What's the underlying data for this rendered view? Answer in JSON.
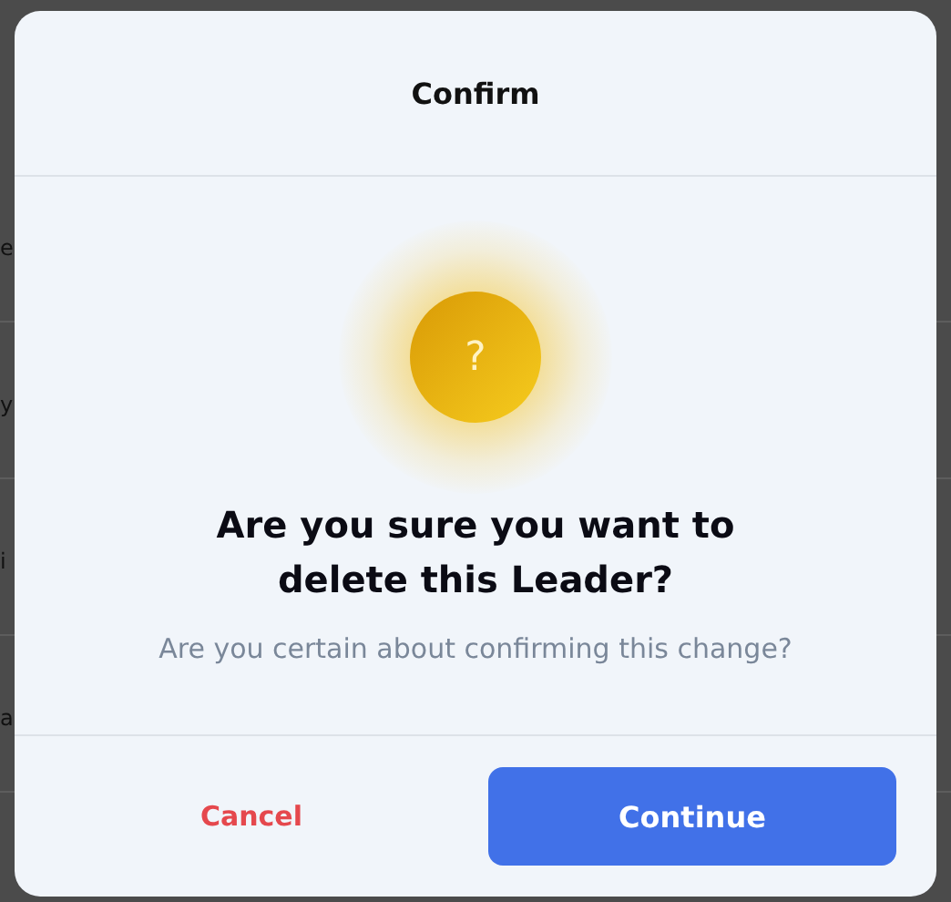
{
  "background_rows": [
    {
      "name": "e"
    },
    {
      "name": "y"
    },
    {
      "name": "i"
    },
    {
      "name": "a"
    }
  ],
  "dialog": {
    "title": "Confirm",
    "icon": "?",
    "heading": "Are you sure you want to delete this Leader?",
    "message": "Are you certain about confirming this change?",
    "buttons": [
      {
        "label": "Cancel",
        "kind": "text"
      },
      {
        "label": "Continue",
        "kind": "primary"
      }
    ]
  }
}
